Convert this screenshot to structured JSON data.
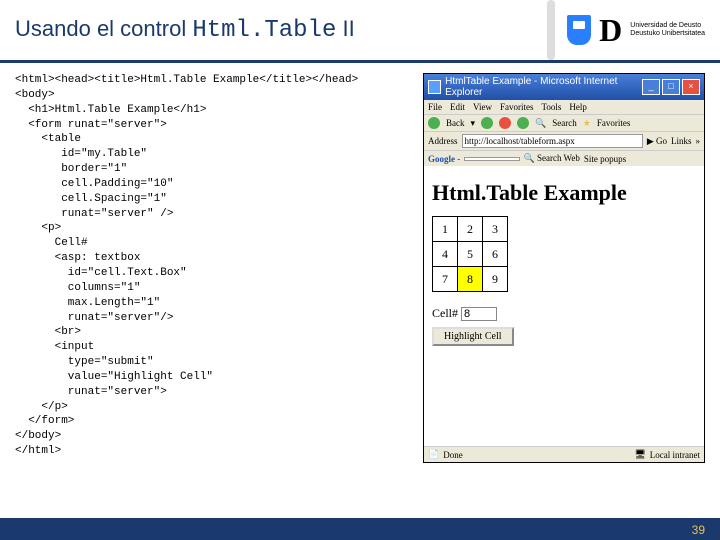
{
  "slide": {
    "title_prefix": "Usando el control ",
    "title_code": "Html.Table",
    "title_suffix": " II",
    "page_number": "39",
    "uni_line1": "Universidad de Deusto",
    "uni_line2": "Deustuko Unibertsitatea"
  },
  "code": "<html><head><title>Html.Table Example</title></head>\n<body>\n  <h1>Html.Table Example</h1>\n  <form runat=\"server\">\n    <table\n       id=\"my.Table\"\n       border=\"1\"\n       cell.Padding=\"10\"\n       cell.Spacing=\"1\"\n       runat=\"server\" />\n    <p>\n      Cell#\n      <asp: textbox\n        id=\"cell.Text.Box\"\n        columns=\"1\"\n        max.Length=\"1\"\n        runat=\"server\"/>\n      <br>\n      <input\n        type=\"submit\"\n        value=\"Highlight Cell\"\n        runat=\"server\">\n    </p>\n  </form>\n</body>\n</html>",
  "browser": {
    "title": "HtmlTable Example - Microsoft Internet Explorer",
    "menu": [
      "File",
      "Edit",
      "View",
      "Favorites",
      "Tools",
      "Help"
    ],
    "back": "Back",
    "search": "Search",
    "favorites": "Favorites",
    "address_label": "Address",
    "url": "http://localhost/tableform.aspx",
    "go": "Go",
    "links": "Links",
    "google": "Google -",
    "search_web": "Search Web",
    "site_popups": "Site popups",
    "page_heading": "Html.Table Example",
    "cells": [
      [
        "1",
        "2",
        "3"
      ],
      [
        "4",
        "5",
        "6"
      ],
      [
        "7",
        "8",
        "9"
      ]
    ],
    "highlighted": "8",
    "cell_label": "Cell#",
    "cell_value": "8",
    "highlight_btn": "Highlight Cell",
    "done": "Done",
    "intranet": "Local intranet"
  }
}
